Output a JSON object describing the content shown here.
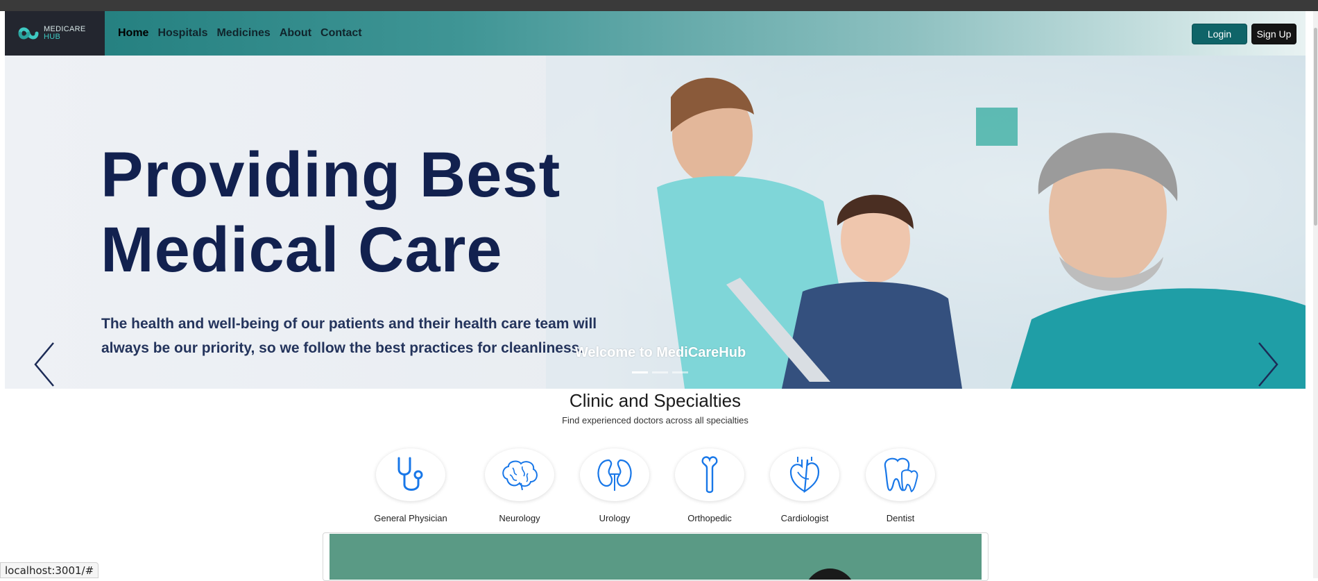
{
  "brand": {
    "logo_line1": "MEDICARE",
    "logo_line2": "HUB"
  },
  "nav": {
    "links": [
      {
        "label": "Home",
        "active": true
      },
      {
        "label": "Hospitals"
      },
      {
        "label": "Medicines"
      },
      {
        "label": "About"
      },
      {
        "label": "Contact"
      }
    ],
    "login_label": "Login",
    "signup_label": "Sign Up"
  },
  "hero": {
    "title_line1": "Providing Best",
    "title_line2": "Medical Care",
    "subtitle_line1": "The health and well-being of our patients and their health care team will",
    "subtitle_line2": "always be our priority, so we follow the best practices for cleanliness.",
    "caption": "Welcome to MediCareHub",
    "slides": 3,
    "active_slide": 1
  },
  "specialties": {
    "title": "Clinic and Specialties",
    "subtitle": "Find experienced doctors across all specialties",
    "items": [
      {
        "label": "General Physician",
        "icon": "stethoscope-icon"
      },
      {
        "label": "Neurology",
        "icon": "brain-icon"
      },
      {
        "label": "Urology",
        "icon": "kidney-icon"
      },
      {
        "label": "Orthopedic",
        "icon": "bone-icon"
      },
      {
        "label": "Cardiologist",
        "icon": "heart-icon"
      },
      {
        "label": "Dentist",
        "icon": "tooth-icon"
      }
    ]
  },
  "status_bar": {
    "url": "localhost:3001/#"
  },
  "colors": {
    "icon_blue": "#1877e8",
    "hero_title": "#12214f",
    "login_bg": "#0f6468",
    "nav_start": "#1e7b7b"
  }
}
